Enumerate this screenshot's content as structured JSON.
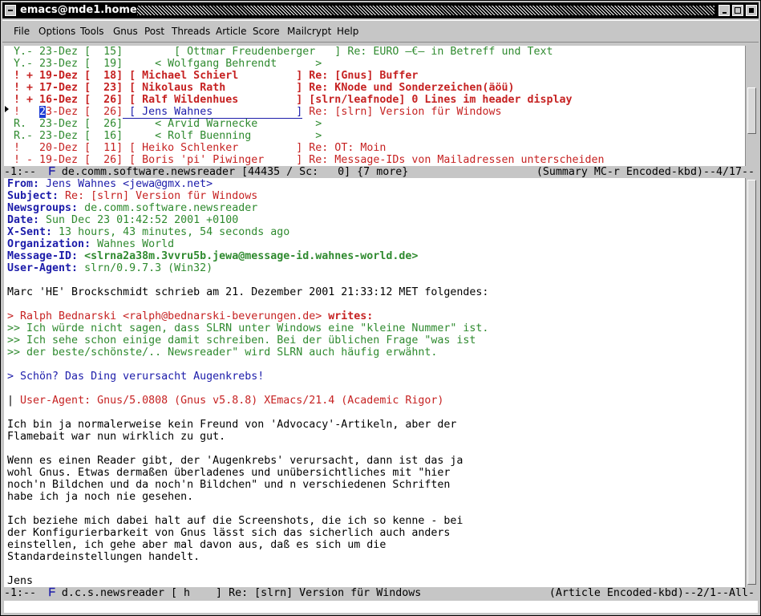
{
  "window": {
    "title": "emacs@mde1.home"
  },
  "menu": [
    "File",
    "Options",
    "Tools",
    "Gnus",
    "Post",
    "Threads",
    "Article",
    "Score",
    "Mailcrypt",
    "Help"
  ],
  "summary_lines": [
    {
      "mark": "Y.-",
      "date": "23-Dez",
      "lines": "[  15]",
      "author": "        [ Ottmar Freudenberger   ]",
      "subject": "Re: EURO —€— in Betreff und Text",
      "color": "g",
      "bold": false
    },
    {
      "mark": "Y.-",
      "date": "23-Dez",
      "lines": "[  19]",
      "author": "     < Wolfgang Behrendt      >",
      "subject": "",
      "color": "g",
      "bold": false
    },
    {
      "mark": "! +",
      "date": "19-Dez",
      "lines": "[  18]",
      "author": " [ Michael Schierl         ]",
      "subject": "Re: [Gnus] Buffer",
      "color": "r",
      "bold": true
    },
    {
      "mark": "! +",
      "date": "17-Dez",
      "lines": "[  23]",
      "author": " [ Nikolaus Rath           ]",
      "subject": "Re: KNode und Sonderzeichen(äöü)",
      "color": "r",
      "bold": true
    },
    {
      "mark": "! +",
      "date": "16-Dez",
      "lines": "[  26]",
      "author": " [ Ralf Wildenhues         ]",
      "subject": "[slrn/leafnode] 0 Lines im header display",
      "color": "r",
      "bold": true
    },
    {
      "mark": "!  ",
      "date": "23-Dez",
      "lines": "[  26]",
      "author": " [ Jens Wahnes             ]",
      "subject": "Re: [slrn] Version für Windows",
      "color": "r",
      "bold": false,
      "current": true
    },
    {
      "mark": "R. ",
      "date": "23-Dez",
      "lines": "[  26]",
      "author": "     < Arvid Warnecke         >",
      "subject": "",
      "color": "g",
      "bold": false
    },
    {
      "mark": "R.-",
      "date": "23-Dez",
      "lines": "[  16]",
      "author": "     < Rolf Buenning          >",
      "subject": "",
      "color": "g",
      "bold": false
    },
    {
      "mark": "!  ",
      "date": "20-Dez",
      "lines": "[  11]",
      "author": " [ Heiko Schlenker         ]",
      "subject": "Re: OT: Moin",
      "color": "r",
      "bold": false
    },
    {
      "mark": "! -",
      "date": "19-Dez",
      "lines": "[  26]",
      "author": " [ Boris 'pi' Piwinger     ]",
      "subject": "Re: Message-IDs von Mailadressen unterscheiden",
      "color": "r",
      "bold": false
    }
  ],
  "modeline_summary": {
    "left": "-1:--  ",
    "icon": "ᖴ",
    "text": " de.comm.software.newsreader [44435 / Sc:   0] {7 more}",
    "right": "(Summary MC-r Encoded-kbd)--4/17--"
  },
  "headers": [
    {
      "name": "From:",
      "value": " Jens Wahnes <jewa@gmx.net>",
      "vcolor": "b"
    },
    {
      "name": "Subject:",
      "value": " Re: [slrn] Version für Windows",
      "vcolor": "r"
    },
    {
      "name": "Newsgroups:",
      "value": " de.comm.software.newsreader",
      "vcolor": "g"
    },
    {
      "name": "Date:",
      "value": " Sun Dec 23 01:42:52 2001 +0100",
      "vcolor": "g"
    },
    {
      "name": "X-Sent:",
      "value": " 13 hours, 43 minutes, 54 seconds ago",
      "vcolor": "g"
    },
    {
      "name": "Organization:",
      "value": " Wahnes World",
      "vcolor": "g"
    },
    {
      "name": "Message-ID:",
      "value": " <slrna2a38m.3vvru5b.jewa@message-id.wahnes-world.de>",
      "vcolor": "gb"
    },
    {
      "name": "User-Agent:",
      "value": " slrn/0.9.7.3 (Win32)",
      "vcolor": "g"
    }
  ],
  "body": [
    {
      "t": "",
      "c": "k"
    },
    {
      "t": "Marc 'HE' Brockschmidt schrieb am 21. Dezember 2001 21:33:12 MET folgendes:",
      "c": "k"
    },
    {
      "t": "",
      "c": "k"
    },
    {
      "t": "> Ralph Bednarski <ralph@bednarski-beverungen.de>",
      "c": "r",
      "suffix": " writes:"
    },
    {
      "t": ">> Ich würde nicht sagen, dass SLRN unter Windows eine \"kleine Nummer\" ist.",
      "c": "g"
    },
    {
      "t": ">> Ich sehe schon einige damit schreiben. Bei der üblichen Frage \"was ist",
      "c": "g"
    },
    {
      "t": ">> der beste/schönste/.. Newsreader\" wird SLRN auch häufig erwähnt.",
      "c": "g"
    },
    {
      "t": "",
      "c": "k"
    },
    {
      "t": "> Schön? Das Ding verursacht Augenkrebs!",
      "c": "b"
    },
    {
      "t": "",
      "c": "k"
    },
    {
      "t": "| User-Agent: Gnus/5.0808 (Gnus v5.8.8) XEmacs/21.4 (Academic Rigor)",
      "c": "r",
      "bar": true
    },
    {
      "t": "",
      "c": "k"
    },
    {
      "t": "Ich bin ja normalerweise kein Freund von 'Advocacy'-Artikeln, aber der",
      "c": "k"
    },
    {
      "t": "Flamebait war nun wirklich zu gut.",
      "c": "k"
    },
    {
      "t": "",
      "c": "k"
    },
    {
      "t": "Wenn es einen Reader gibt, der 'Augenkrebs' verursacht, dann ist das ja",
      "c": "k"
    },
    {
      "t": "wohl Gnus. Etwas dermaßen überladenes und unübersichtliches mit \"hier",
      "c": "k"
    },
    {
      "t": "noch'n Bildchen und da noch'n Bildchen\" und n verschiedenen Schriften",
      "c": "k"
    },
    {
      "t": "habe ich ja noch nie gesehen.",
      "c": "k"
    },
    {
      "t": "",
      "c": "k"
    },
    {
      "t": "Ich beziehe mich dabei halt auf die Screenshots, die ich so kenne - bei",
      "c": "k"
    },
    {
      "t": "der Konfigurierbarkeit von Gnus lässt sich das sicherlich auch anders",
      "c": "k"
    },
    {
      "t": "einstellen, ich gehe aber mal davon aus, daß es sich um die",
      "c": "k"
    },
    {
      "t": "Standardeinstellungen handelt.",
      "c": "k"
    },
    {
      "t": "",
      "c": "k"
    },
    {
      "t": "Jens",
      "c": "k"
    }
  ],
  "modeline_article": {
    "left": "-1:--  ",
    "icon": "ᖴ",
    "text": " d.c.s.newsreader [ h    ] Re: [slrn] Version für Windows",
    "right": "(Article Encoded-kbd)--2/1--All-"
  }
}
